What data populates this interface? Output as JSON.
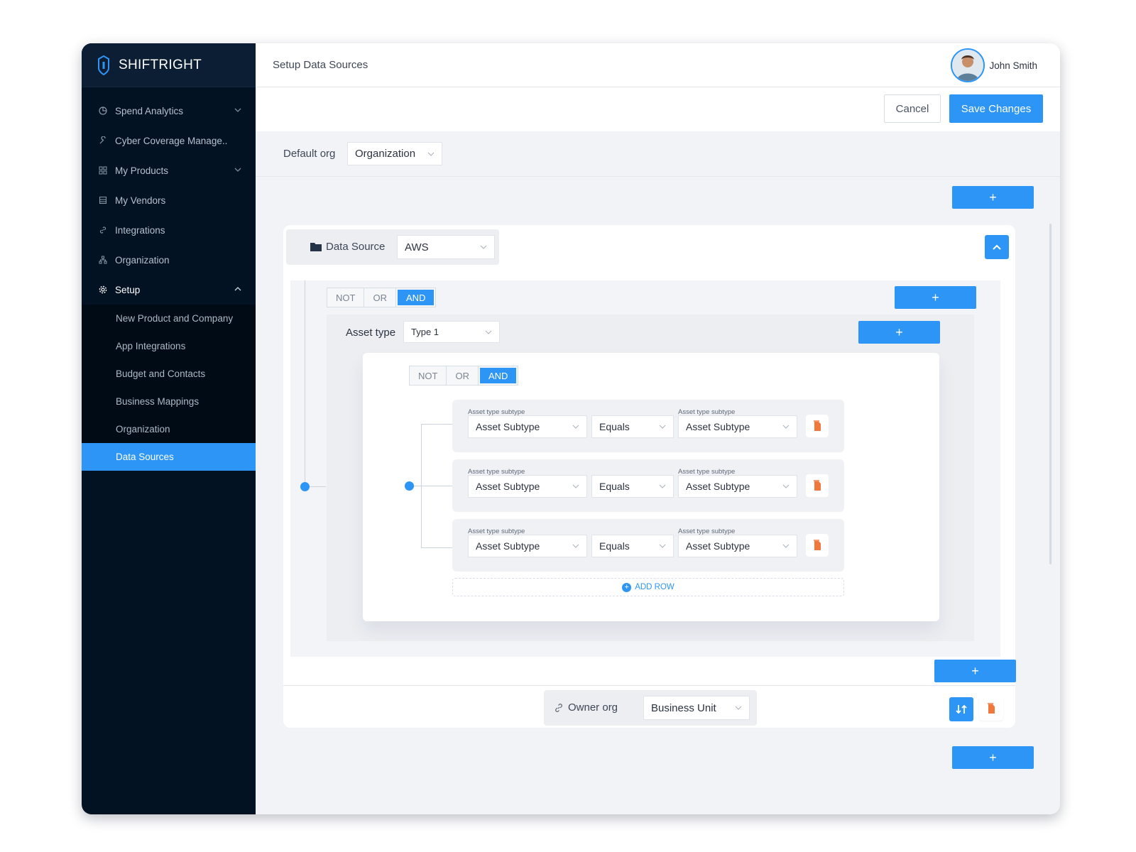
{
  "brand": {
    "name": "SHIFTRIGHT"
  },
  "sidebar": {
    "items": [
      {
        "label": "Spend Analytics",
        "icon": "pie-chart-icon"
      },
      {
        "label": "Cyber Coverage Manage..",
        "icon": "wrench-icon"
      },
      {
        "label": "My Products",
        "icon": "grid-icon"
      },
      {
        "label": "My Vendors",
        "icon": "building-icon"
      },
      {
        "label": "Integrations",
        "icon": "link-icon"
      },
      {
        "label": "Organization",
        "icon": "org-chart-icon"
      },
      {
        "label": "Setup",
        "icon": "gear-icon"
      }
    ],
    "sub_items": [
      {
        "label": "New Product and Company"
      },
      {
        "label": "App Integrations"
      },
      {
        "label": "Budget and Contacts"
      },
      {
        "label": "Business Mappings"
      },
      {
        "label": "Organization"
      },
      {
        "label": "Data Sources"
      }
    ]
  },
  "header": {
    "title": "Setup Data Sources",
    "user_name": "John Smith"
  },
  "actions": {
    "cancel_label": "Cancel",
    "save_label": "Save Changes"
  },
  "default_org": {
    "label": "Default org",
    "value": "Organization"
  },
  "add_label": "+",
  "data_source": {
    "label": "Data Source",
    "value": "AWS"
  },
  "logic_toggle": {
    "not": "NOT",
    "or": "OR",
    "and": "AND",
    "selected": "AND"
  },
  "asset_type": {
    "label": "Asset type",
    "value": "Type 1"
  },
  "conditions": [
    {
      "left_label": "Asset type subtype",
      "left_value": "Asset Subtype",
      "operator": "Equals",
      "right_label": "Asset type subtype",
      "right_value": "Asset Subtype"
    },
    {
      "left_label": "Asset type subtype",
      "left_value": "Asset Subtype",
      "operator": "Equals",
      "right_label": "Asset type subtype",
      "right_value": "Asset Subtype"
    },
    {
      "left_label": "Asset type subtype",
      "left_value": "Asset Subtype",
      "operator": "Equals",
      "right_label": "Asset type subtype",
      "right_value": "Asset Subtype"
    }
  ],
  "add_row_label": "ADD ROW",
  "owner_org": {
    "label": "Owner org",
    "value": "Business Unit"
  },
  "colors": {
    "accent": "#2d95f5",
    "sidebar_bg": "#031223",
    "delete": "#f0783c"
  }
}
